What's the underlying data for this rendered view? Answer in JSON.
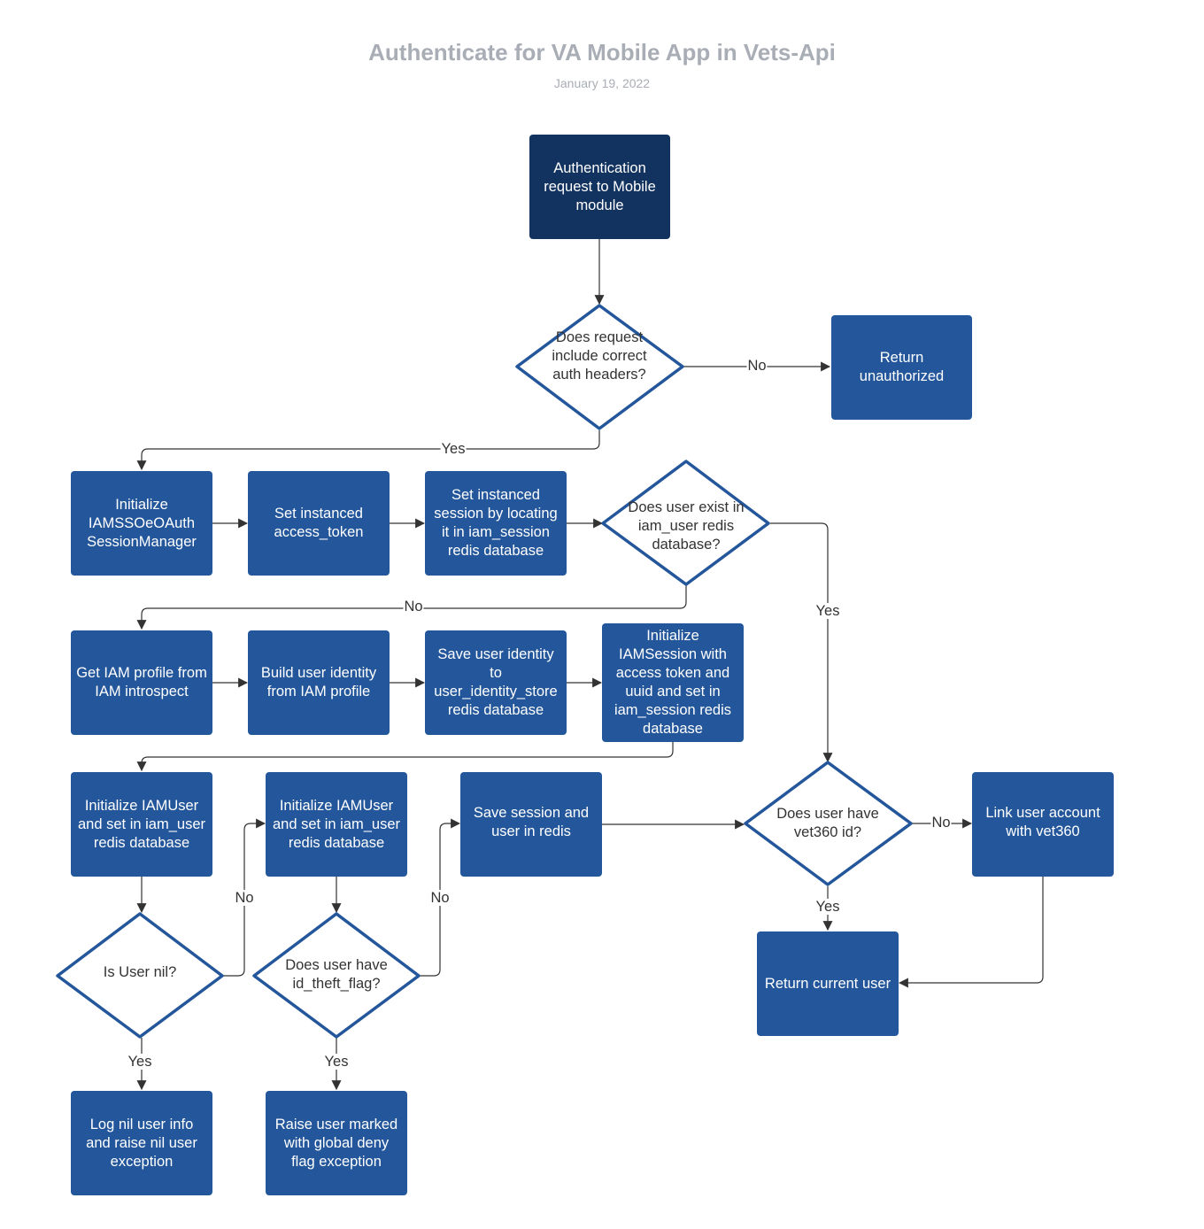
{
  "header": {
    "title": "Authenticate for VA Mobile App in Vets-Api",
    "date": "January 19, 2022"
  },
  "colors": {
    "process_box": "#23569a",
    "start_box": "#12325f",
    "decision_border": "#23569a",
    "connector": "#333333",
    "title_text": "#a9adb5"
  },
  "nodes": {
    "start": "Authentication request to Mobile module",
    "auth_headers_decision": "Does request include correct auth headers?",
    "return_unauthorized": "Return unauthorized",
    "init_session_manager": "Initialize IAMSSOeOAuth SessionManager",
    "set_access_token": "Set instanced access_token",
    "set_session": "Set instanced session by locating it in iam_session redis database",
    "user_exists_decision": "Does user exist in iam_user redis database?",
    "get_iam_profile": "Get IAM profile from IAM introspect",
    "build_user_identity": "Build user identity from IAM profile",
    "save_user_identity": "Save user identity to user_identity_store redis database",
    "init_iam_session": "Initialize IAMSession with access token and uuid and set in iam_session redis database",
    "init_iam_user_1": "Initialize IAMUser and set in iam_user redis database",
    "init_iam_user_2": "Initialize IAMUser and set in iam_user redis database",
    "save_session_user": "Save session and user in redis",
    "vet360_decision": "Does user have vet360 id?",
    "link_vet360": "Link user account with vet360",
    "return_current_user": "Return current user",
    "user_nil_decision": "Is User nil?",
    "id_theft_decision": "Does user have id_theft_flag?",
    "log_nil_user": "Log nil user info and raise nil user exception",
    "raise_deny_flag": "Raise user marked with global deny flag exception"
  },
  "edge_labels": {
    "auth_no": "No",
    "auth_yes": "Yes",
    "exists_no": "No",
    "exists_yes": "Yes",
    "nil_no": "No",
    "nil_yes": "Yes",
    "theft_no": "No",
    "theft_yes": "Yes",
    "vet360_no": "No",
    "vet360_yes": "Yes"
  }
}
